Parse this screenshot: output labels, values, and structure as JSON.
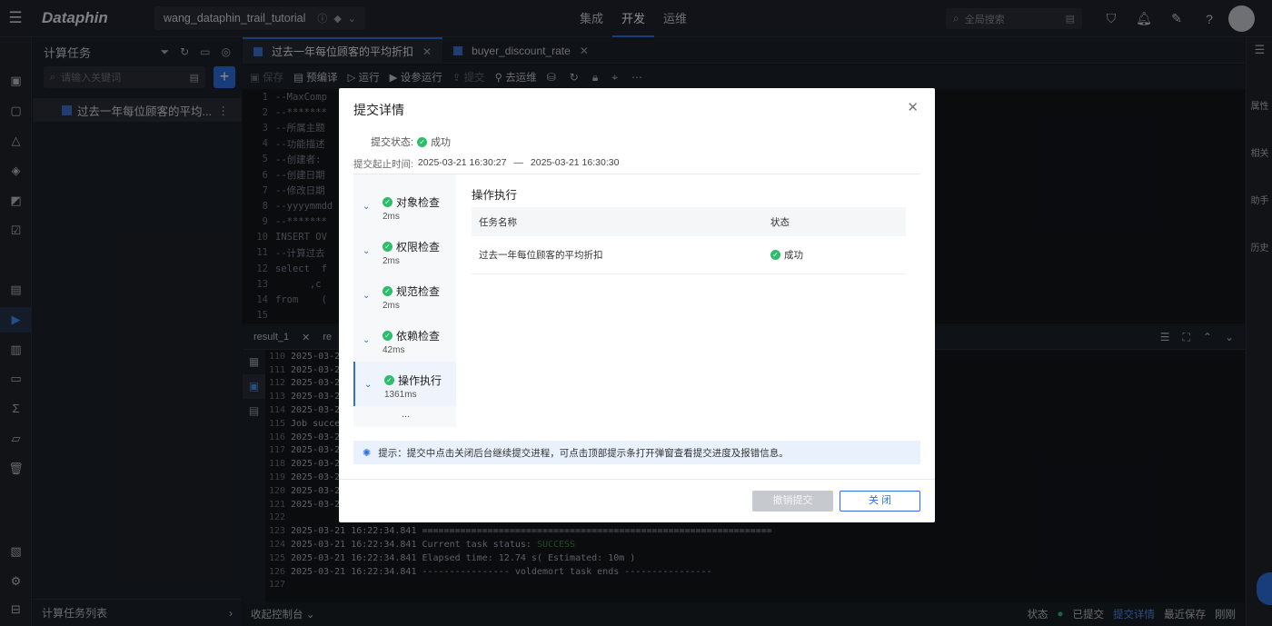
{
  "topbar": {
    "logo": "Dataphin",
    "project": "wang_dataphin_trail_tutorial",
    "nav": [
      "集成",
      "开发",
      "运维"
    ],
    "nav_active": "开发",
    "search_placeholder": "全局搜索"
  },
  "panel": {
    "title": "计算任务",
    "search_placeholder": "请输入关键词",
    "task_item": "过去一年每位顾客的平均...",
    "footer": "计算任务列表"
  },
  "tabs": [
    {
      "label": "过去一年每位顾客的平均折扣"
    },
    {
      "label": "buyer_discount_rate"
    }
  ],
  "toolbar": {
    "save": "保存",
    "precompile": "预编译",
    "run": "运行",
    "param_run": "设参运行",
    "submit": "提交",
    "to_ops": "去运维"
  },
  "editor": {
    "lines": [
      {
        "n": "1",
        "t": "--MaxComp"
      },
      {
        "n": "2",
        "t": "--*******"
      },
      {
        "n": "3",
        "t": "--所属主题"
      },
      {
        "n": "4",
        "t": "--功能描述"
      },
      {
        "n": "5",
        "t": "--创建者:"
      },
      {
        "n": "6",
        "t": "--创建日期"
      },
      {
        "n": "7",
        "t": "--修改日期"
      },
      {
        "n": "8",
        "t": "--yyyymmdd"
      },
      {
        "n": "9",
        "t": "--*******"
      },
      {
        "n": "10",
        "t": "INSERT OV"
      },
      {
        "n": "11",
        "t": "--计算过去"
      },
      {
        "n": "12",
        "t": "select  f"
      },
      {
        "n": "13",
        "t": "      ,c"
      },
      {
        "n": "14",
        "t": "from    ("
      },
      {
        "n": "15",
        "t": ""
      }
    ]
  },
  "results": {
    "tabs": [
      "result_1",
      "re"
    ]
  },
  "log": {
    "lines": [
      {
        "n": "110",
        "t": "2025-03-21"
      },
      {
        "n": "111",
        "t": "2025-03-21"
      },
      {
        "n": "112",
        "t": "2025-03-21"
      },
      {
        "n": "113",
        "t": "2025-03-21"
      },
      {
        "n": "114",
        "t": "2025-03-21"
      },
      {
        "n": "115",
        "t": "Job succe"
      },
      {
        "n": "116",
        "t": "2025-03-21"
      },
      {
        "n": "117",
        "t": "2025-03-21"
      },
      {
        "n": "118",
        "t": "2025-03-21"
      },
      {
        "n": "119",
        "t": "2025-03-21"
      },
      {
        "n": "120",
        "t": "2025-03-21"
      },
      {
        "n": "121",
        "t": "2025-03-21"
      },
      {
        "n": "122",
        "t": ""
      },
      {
        "n": "123",
        "t": "2025-03-21 16:22:34.841 ================================================================"
      },
      {
        "n": "124",
        "t": "2025-03-21 16:22:34.841 Current task status: ",
        "ok": "SUCCESS"
      },
      {
        "n": "125",
        "t": "2025-03-21 16:22:34.841 Elapsed time: 12.74 s( Estimated: 10m )"
      },
      {
        "n": "126",
        "t": "2025-03-21 16:22:34.841 ---------------- voldemort task ends ----------------"
      },
      {
        "n": "127",
        "t": ""
      }
    ]
  },
  "statusbar": {
    "left": "收起控制台",
    "state_label": "状态",
    "state_value": "已提交",
    "submit_detail": "提交详情",
    "recent_save": "最近保存",
    "recent_time": "刚刚"
  },
  "rightrail": [
    "属性",
    "相关",
    "助手",
    "历史"
  ],
  "modal": {
    "title": "提交详情",
    "status_label": "提交状态:",
    "status_value": "成功",
    "time_label": "提交起止时间:",
    "time_start": "2025-03-21 16:30:27",
    "time_sep": "—",
    "time_end": "2025-03-21 16:30:30",
    "steps": [
      {
        "name": "对象检查",
        "ms": "2ms"
      },
      {
        "name": "权限检查",
        "ms": "2ms"
      },
      {
        "name": "规范检查",
        "ms": "2ms"
      },
      {
        "name": "依赖检查",
        "ms": "42ms"
      },
      {
        "name": "操作执行",
        "ms": "1361ms"
      }
    ],
    "steps_more": "...",
    "op_title": "操作执行",
    "table_headers": [
      "任务名称",
      "状态"
    ],
    "table_row": {
      "name": "过去一年每位顾客的平均折扣",
      "status": "成功"
    },
    "tip": "提示：提交中点击关闭后台继续提交进程，可点击顶部提示条打开弹窗查看提交进度及报错信息。",
    "btn_revoke": "撤销提交",
    "btn_close": "关 闭"
  },
  "colors": {
    "accent": "#2f6fe0",
    "success": "#2ebd6b"
  }
}
